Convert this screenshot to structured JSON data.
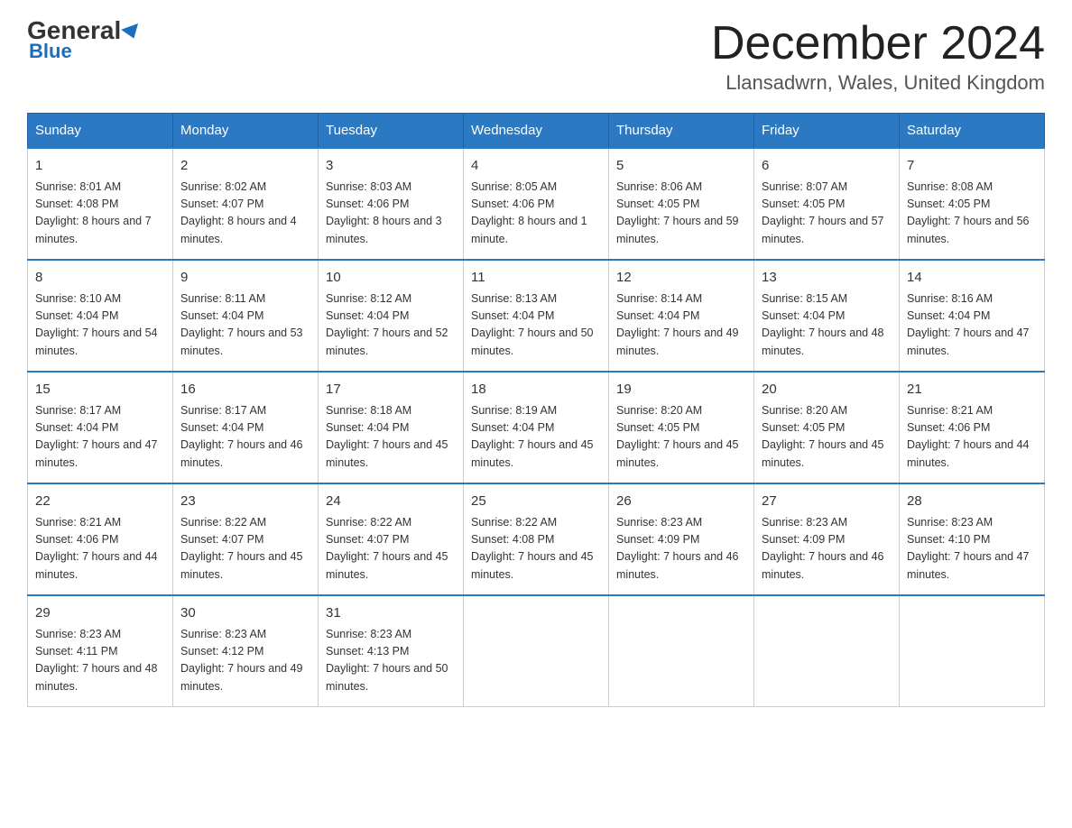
{
  "header": {
    "logo_line1": "General",
    "logo_line2": "Blue",
    "month_title": "December 2024",
    "location": "Llansadwrn, Wales, United Kingdom"
  },
  "days_of_week": [
    "Sunday",
    "Monday",
    "Tuesday",
    "Wednesday",
    "Thursday",
    "Friday",
    "Saturday"
  ],
  "weeks": [
    [
      {
        "day": "1",
        "sunrise": "8:01 AM",
        "sunset": "4:08 PM",
        "daylight": "8 hours and 7 minutes."
      },
      {
        "day": "2",
        "sunrise": "8:02 AM",
        "sunset": "4:07 PM",
        "daylight": "8 hours and 4 minutes."
      },
      {
        "day": "3",
        "sunrise": "8:03 AM",
        "sunset": "4:06 PM",
        "daylight": "8 hours and 3 minutes."
      },
      {
        "day": "4",
        "sunrise": "8:05 AM",
        "sunset": "4:06 PM",
        "daylight": "8 hours and 1 minute."
      },
      {
        "day": "5",
        "sunrise": "8:06 AM",
        "sunset": "4:05 PM",
        "daylight": "7 hours and 59 minutes."
      },
      {
        "day": "6",
        "sunrise": "8:07 AM",
        "sunset": "4:05 PM",
        "daylight": "7 hours and 57 minutes."
      },
      {
        "day": "7",
        "sunrise": "8:08 AM",
        "sunset": "4:05 PM",
        "daylight": "7 hours and 56 minutes."
      }
    ],
    [
      {
        "day": "8",
        "sunrise": "8:10 AM",
        "sunset": "4:04 PM",
        "daylight": "7 hours and 54 minutes."
      },
      {
        "day": "9",
        "sunrise": "8:11 AM",
        "sunset": "4:04 PM",
        "daylight": "7 hours and 53 minutes."
      },
      {
        "day": "10",
        "sunrise": "8:12 AM",
        "sunset": "4:04 PM",
        "daylight": "7 hours and 52 minutes."
      },
      {
        "day": "11",
        "sunrise": "8:13 AM",
        "sunset": "4:04 PM",
        "daylight": "7 hours and 50 minutes."
      },
      {
        "day": "12",
        "sunrise": "8:14 AM",
        "sunset": "4:04 PM",
        "daylight": "7 hours and 49 minutes."
      },
      {
        "day": "13",
        "sunrise": "8:15 AM",
        "sunset": "4:04 PM",
        "daylight": "7 hours and 48 minutes."
      },
      {
        "day": "14",
        "sunrise": "8:16 AM",
        "sunset": "4:04 PM",
        "daylight": "7 hours and 47 minutes."
      }
    ],
    [
      {
        "day": "15",
        "sunrise": "8:17 AM",
        "sunset": "4:04 PM",
        "daylight": "7 hours and 47 minutes."
      },
      {
        "day": "16",
        "sunrise": "8:17 AM",
        "sunset": "4:04 PM",
        "daylight": "7 hours and 46 minutes."
      },
      {
        "day": "17",
        "sunrise": "8:18 AM",
        "sunset": "4:04 PM",
        "daylight": "7 hours and 45 minutes."
      },
      {
        "day": "18",
        "sunrise": "8:19 AM",
        "sunset": "4:04 PM",
        "daylight": "7 hours and 45 minutes."
      },
      {
        "day": "19",
        "sunrise": "8:20 AM",
        "sunset": "4:05 PM",
        "daylight": "7 hours and 45 minutes."
      },
      {
        "day": "20",
        "sunrise": "8:20 AM",
        "sunset": "4:05 PM",
        "daylight": "7 hours and 45 minutes."
      },
      {
        "day": "21",
        "sunrise": "8:21 AM",
        "sunset": "4:06 PM",
        "daylight": "7 hours and 44 minutes."
      }
    ],
    [
      {
        "day": "22",
        "sunrise": "8:21 AM",
        "sunset": "4:06 PM",
        "daylight": "7 hours and 44 minutes."
      },
      {
        "day": "23",
        "sunrise": "8:22 AM",
        "sunset": "4:07 PM",
        "daylight": "7 hours and 45 minutes."
      },
      {
        "day": "24",
        "sunrise": "8:22 AM",
        "sunset": "4:07 PM",
        "daylight": "7 hours and 45 minutes."
      },
      {
        "day": "25",
        "sunrise": "8:22 AM",
        "sunset": "4:08 PM",
        "daylight": "7 hours and 45 minutes."
      },
      {
        "day": "26",
        "sunrise": "8:23 AM",
        "sunset": "4:09 PM",
        "daylight": "7 hours and 46 minutes."
      },
      {
        "day": "27",
        "sunrise": "8:23 AM",
        "sunset": "4:09 PM",
        "daylight": "7 hours and 46 minutes."
      },
      {
        "day": "28",
        "sunrise": "8:23 AM",
        "sunset": "4:10 PM",
        "daylight": "7 hours and 47 minutes."
      }
    ],
    [
      {
        "day": "29",
        "sunrise": "8:23 AM",
        "sunset": "4:11 PM",
        "daylight": "7 hours and 48 minutes."
      },
      {
        "day": "30",
        "sunrise": "8:23 AM",
        "sunset": "4:12 PM",
        "daylight": "7 hours and 49 minutes."
      },
      {
        "day": "31",
        "sunrise": "8:23 AM",
        "sunset": "4:13 PM",
        "daylight": "7 hours and 50 minutes."
      },
      null,
      null,
      null,
      null
    ]
  ],
  "labels": {
    "sunrise": "Sunrise:",
    "sunset": "Sunset:",
    "daylight": "Daylight:"
  }
}
